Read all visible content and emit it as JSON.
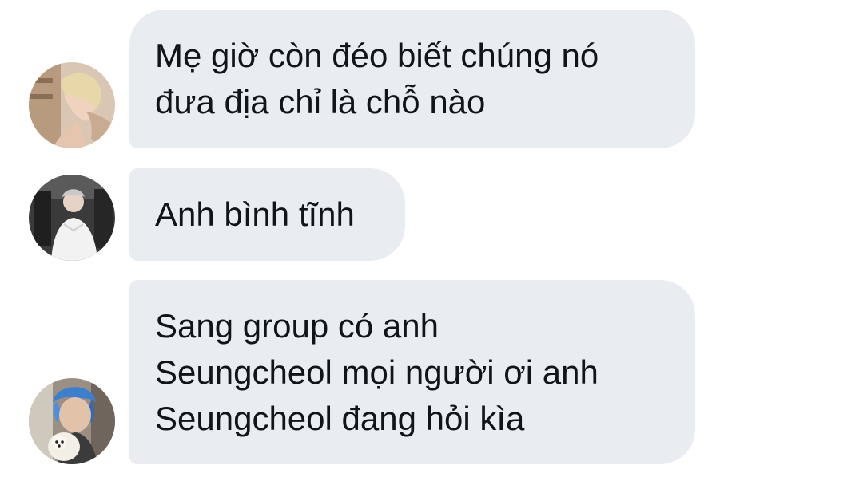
{
  "conversation": {
    "messages": [
      {
        "avatar": "avatar-blond-profile",
        "lines": [
          "Mẹ giờ còn đéo biết chúng nó",
          "đưa địa chỉ là chỗ nào"
        ]
      },
      {
        "avatar": "avatar-white-shirt",
        "lines": [
          "Anh bình tĩnh"
        ]
      },
      {
        "avatar": "avatar-blue-hair-dog",
        "lines": [
          "Sang group có anh",
          "Seungcheol mọi người ơi anh",
          "Seungcheol đang hỏi kìa"
        ]
      }
    ]
  },
  "colors": {
    "bubble_background": "#e9ecf1",
    "text": "#111418",
    "page_background": "#ffffff"
  }
}
